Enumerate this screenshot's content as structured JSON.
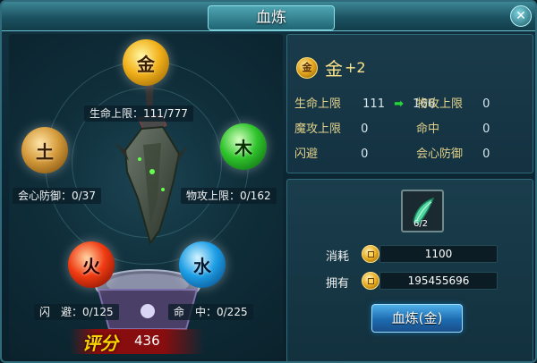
{
  "window": {
    "title": "血炼",
    "close_glyph": "✕"
  },
  "left_panel": {
    "orbs": {
      "top": {
        "char": "金"
      },
      "left": {
        "char": "土"
      },
      "right": {
        "char": "木"
      },
      "bottom_left": {
        "char": "火"
      },
      "bottom_right": {
        "char": "水"
      }
    },
    "stats": {
      "top": "生命上限：111/777",
      "left": "会心防御：0/37",
      "right": "物攻上限：0/162",
      "bottom_left": "闪　避：0/125",
      "bottom_right": "命　中：0/225"
    },
    "score": {
      "label": "评分",
      "value": "436"
    }
  },
  "info_panel": {
    "element": {
      "icon_char": "金",
      "name": "金",
      "level": "+2"
    },
    "attributes": [
      {
        "name": "生命上限",
        "value": "111",
        "arrow": "➡",
        "next": "166"
      },
      {
        "name": "物攻上限",
        "value": "0"
      },
      {
        "name": "魔攻上限",
        "value": "0"
      },
      {
        "name": "命中",
        "value": "0"
      },
      {
        "name": "闪避",
        "value": "0"
      },
      {
        "name": "会心防御",
        "value": "0"
      }
    ]
  },
  "cost_panel": {
    "material": {
      "count": "6/2",
      "icon": "jade-fang-icon"
    },
    "consume": {
      "label": "消耗",
      "value": "1100"
    },
    "own": {
      "label": "拥有",
      "value": "195455696"
    },
    "button": {
      "label": "血炼(金)"
    }
  },
  "colors": {
    "gold_text": "#ffe58a",
    "attr_key": "#e0d08a",
    "up_arrow": "#27d43a",
    "button_blue": "#1c6bb1"
  }
}
